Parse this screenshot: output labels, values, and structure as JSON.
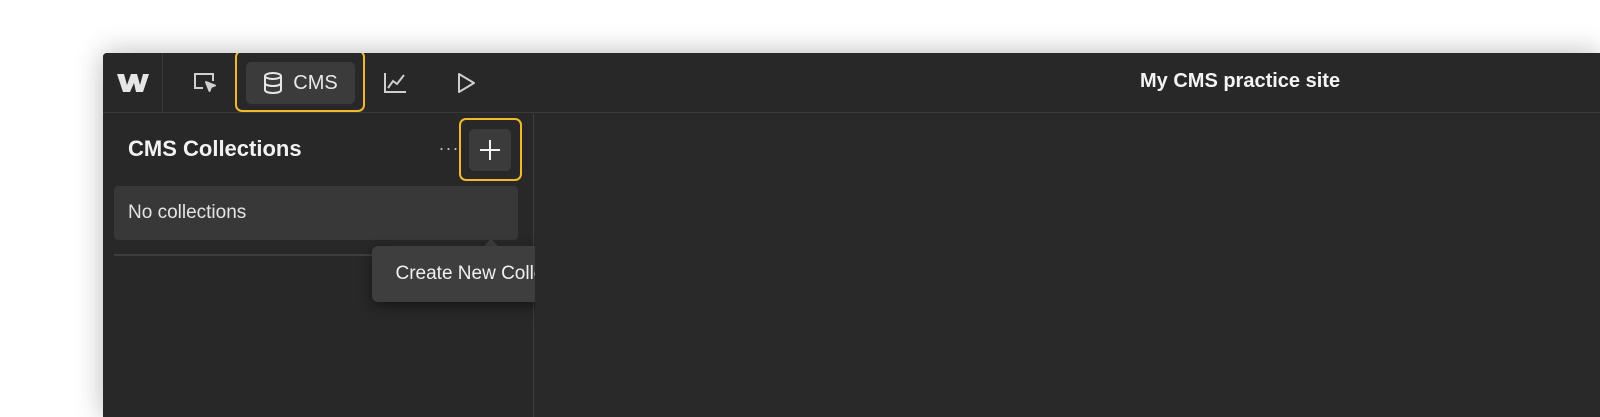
{
  "app": {
    "site_title": "My CMS practice site"
  },
  "topbar": {
    "logo_icon": "webflow-logo-icon",
    "nav": [
      {
        "icon": "designer-cursor-icon",
        "label": ""
      },
      {
        "icon": "database-icon",
        "label": "CMS",
        "active": true
      },
      {
        "icon": "analytics-chart-icon",
        "label": ""
      },
      {
        "icon": "play-preview-icon",
        "label": ""
      }
    ]
  },
  "sidebar": {
    "title": "CMS Collections",
    "more_label": "···",
    "add_icon": "plus-icon",
    "empty_text": "No collections"
  },
  "tooltip": {
    "text": "Create New Collection"
  },
  "colors": {
    "highlight": "#f2b92c",
    "background": "#292929",
    "surface": "#3b3b3b"
  }
}
